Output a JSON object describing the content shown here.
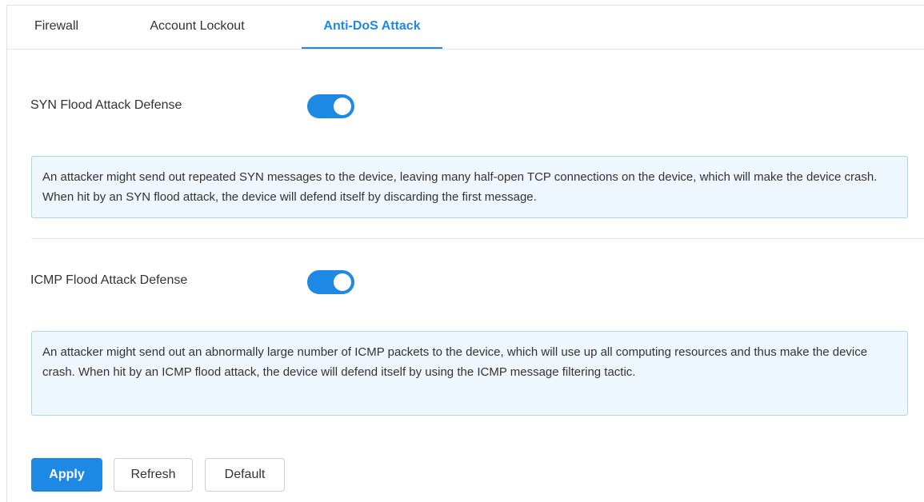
{
  "tabs": [
    {
      "label": "Firewall"
    },
    {
      "label": "Account Lockout"
    },
    {
      "label": "Anti-DoS Attack"
    }
  ],
  "active_tab": "Anti-DoS Attack",
  "settings": {
    "syn": {
      "label": "SYN Flood Attack Defense",
      "enabled": true,
      "note": "An attacker might send out repeated SYN messages to the device, leaving many half-open TCP connections on the device, which will make the device crash. When hit by an SYN flood attack, the device will defend itself by discarding the first message."
    },
    "icmp": {
      "label": "ICMP Flood Attack Defense",
      "enabled": true,
      "note": "An attacker might send out an abnormally large number of ICMP packets to the device, which will use up all computing resources and thus make the device crash. When hit by an ICMP flood attack, the device will defend itself by using the ICMP message filtering tactic."
    }
  },
  "buttons": {
    "apply": "Apply",
    "refresh": "Refresh",
    "default": "Default"
  },
  "colors": {
    "accent": "#1e88e5",
    "toggle_on": "#1e88e5",
    "note_bg": "#eef7fd",
    "note_border": "#a9d4f2"
  }
}
